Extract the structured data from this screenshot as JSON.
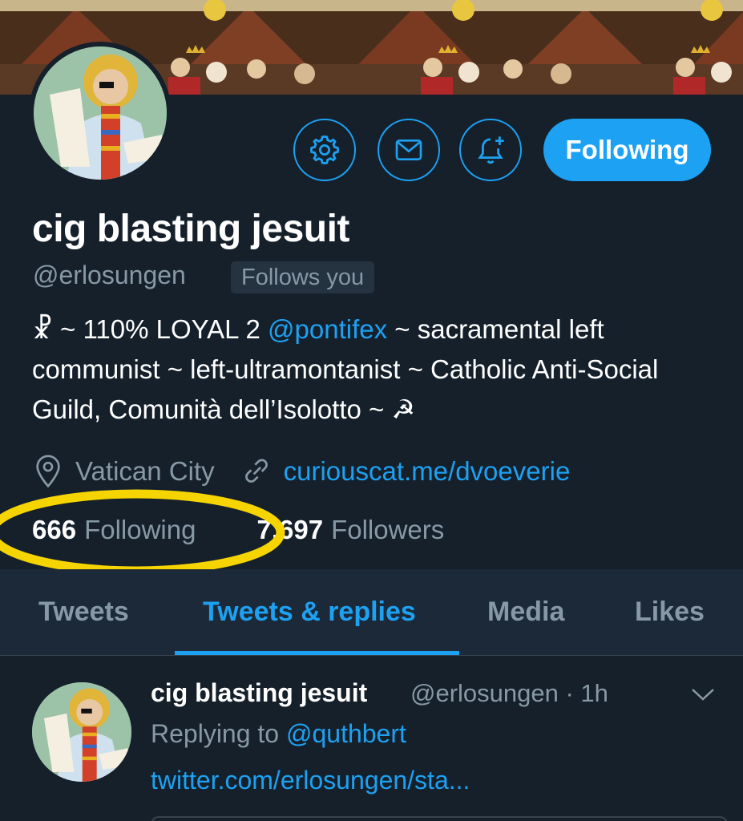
{
  "profile": {
    "display_name": "cig blasting jesuit",
    "handle": "@erlosungen",
    "follows_you": "Follows you",
    "bio": {
      "part1": "☧ ~ 110% LOYAL 2 ",
      "mention": "@pontifex",
      "part2": " ~ sacramental left communist ~ left-ultramontanist ~ Catholic Anti-Social Guild, Comunità dell’Isolotto ~ ☭"
    },
    "location": "Vatican City",
    "website": "curiouscat.me/dvoeverie",
    "following_count": "666",
    "following_label": "Following",
    "followers_count": "7,697",
    "followers_label": "Followers"
  },
  "actions": {
    "settings_icon": "gear-icon",
    "message_icon": "envelope-icon",
    "notify_icon": "bell-plus-icon",
    "follow_label": "Following"
  },
  "tabs": [
    {
      "label": "Tweets"
    },
    {
      "label": "Tweets & replies"
    },
    {
      "label": "Media"
    },
    {
      "label": "Likes"
    }
  ],
  "active_tab": "Tweets & replies",
  "tweet": {
    "name": "cig blasting jesuit",
    "handle_time": "@erlosungen · 1h",
    "replying_prefix": "Replying to ",
    "replying_to": "@quthbert",
    "link": "twitter.com/erlosungen/sta..."
  },
  "colors": {
    "background": "#15202b",
    "accent": "#1da1f2",
    "secondary_text": "#8899a6",
    "annotation": "#f5d400"
  }
}
